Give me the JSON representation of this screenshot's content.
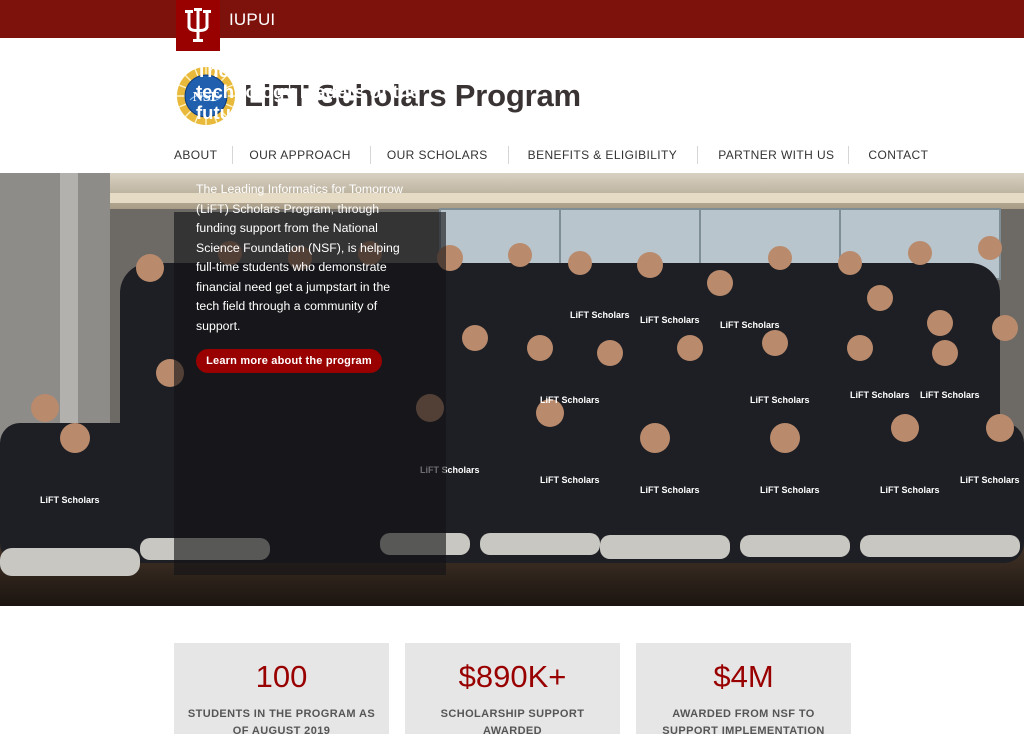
{
  "header": {
    "institution": "IUPUI",
    "logo_icon": "iu-trident-icon",
    "brand_color": "#7d110c",
    "site_title": "LiFT Scholars Program",
    "partner_logo": "nsf-logo-icon"
  },
  "nav": {
    "items": [
      {
        "label": "ABOUT"
      },
      {
        "label": "OUR APPROACH"
      },
      {
        "label": "OUR SCHOLARS"
      },
      {
        "label": "BENEFITS & ELIGIBILITY"
      },
      {
        "label": "PARTNER WITH US"
      },
      {
        "label": "CONTACT"
      }
    ]
  },
  "hero": {
    "title": "The information technology leaders of the future are here...and ready for tomorrow's workforce",
    "body": "The Leading Informatics for Tomorrow (LiFT) Scholars Program, through funding support from the National Science Foundation (NSF), is helping full-time students who demonstrate financial need get a jumpstart in the tech field through a community of support.",
    "button_label": "Learn more about the program",
    "accent_color": "#990000"
  },
  "stats": [
    {
      "value": "100",
      "label": "STUDENTS IN THE PROGRAM AS OF AUGUST 2019"
    },
    {
      "value": "$890K+",
      "label": "SCHOLARSHIP SUPPORT AWARDED"
    },
    {
      "value": "$4M",
      "label": "AWARDED FROM NSF TO SUPPORT IMPLEMENTATION"
    }
  ]
}
